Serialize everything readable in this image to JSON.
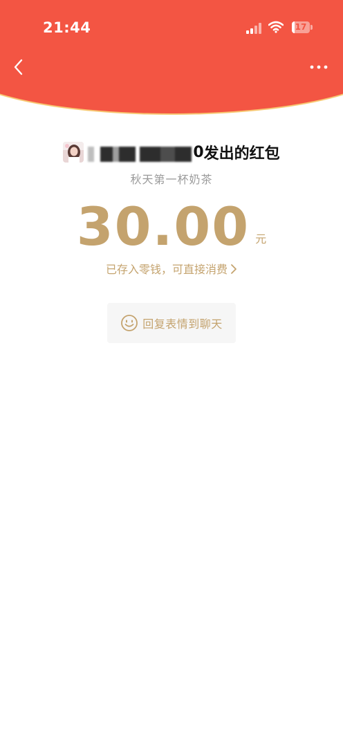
{
  "status_bar": {
    "time": "21:44",
    "battery_level": "17",
    "icons": [
      "signal-icon",
      "wifi-icon",
      "battery-icon"
    ]
  },
  "nav": {
    "back_icon": "chevron-left-icon",
    "more_icon": "more-dots-icon"
  },
  "sender": {
    "name_visible": "0",
    "suffix": "发出的红包"
  },
  "greeting": "秋天第一杯奶茶",
  "amount": {
    "value": "30.00",
    "currency": "元"
  },
  "saved_link": {
    "label": "已存入零钱，可直接消费",
    "icon": "chevron-right-icon"
  },
  "reply_button": {
    "label": "回复表情到聊天",
    "icon": "smile-icon"
  },
  "colors": {
    "header_red": "#F35543",
    "gold": "#C4A36E",
    "gray_text": "#9a9a9a"
  }
}
